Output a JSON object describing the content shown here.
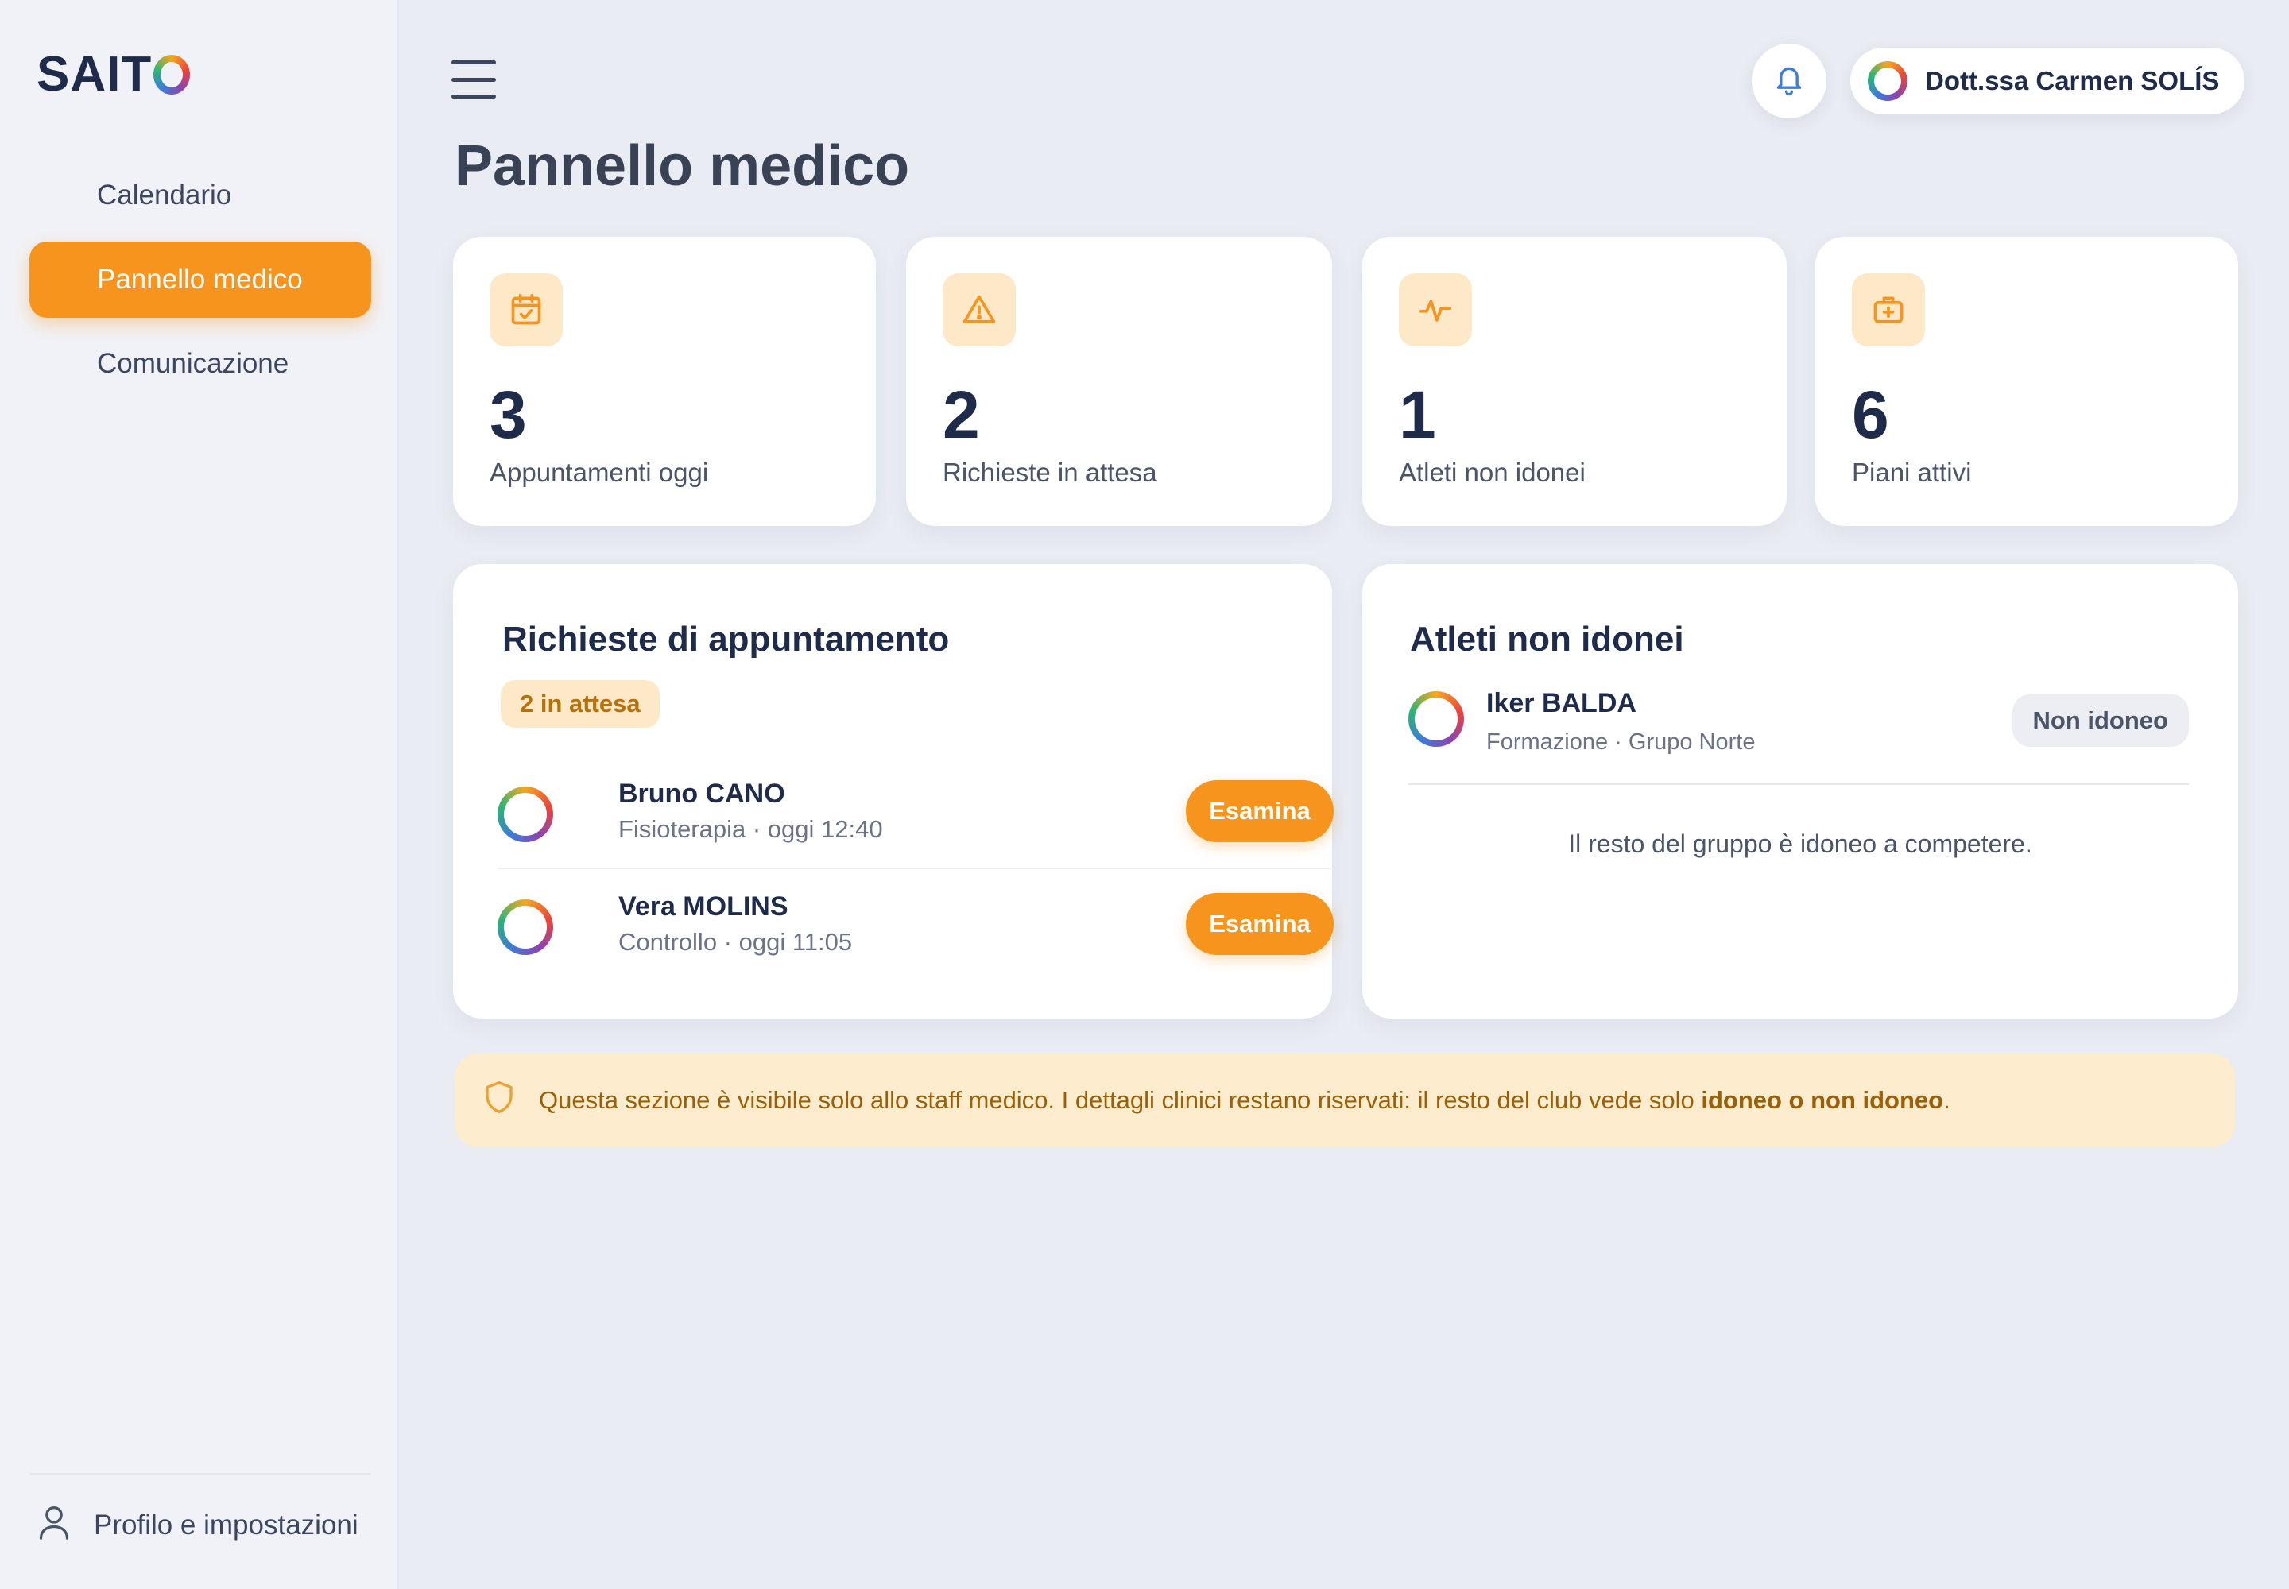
{
  "sidebar": {
    "logo_text": "SAIT",
    "items": [
      {
        "label": "Calendario"
      },
      {
        "label": "Pannello medico"
      },
      {
        "label": "Comunicazione"
      }
    ],
    "profile_label": "Profilo e impostazioni"
  },
  "header": {
    "user_name": "Dott.ssa Carmen SOLÍS"
  },
  "page": {
    "title": "Pannello medico"
  },
  "stats": [
    {
      "icon": "calendar-check-icon",
      "value": "3",
      "label": "Appuntamenti oggi"
    },
    {
      "icon": "warning-icon",
      "value": "2",
      "label": "Richieste in attesa"
    },
    {
      "icon": "activity-icon",
      "value": "1",
      "label": "Atleti non idonei"
    },
    {
      "icon": "medical-kit-icon",
      "value": "6",
      "label": "Piani attivi"
    }
  ],
  "requests": {
    "title": "Richieste di appuntamento",
    "badge": "2 in attesa",
    "items": [
      {
        "name": "Bruno CANO",
        "sub": "Fisioterapia · oggi 12:40",
        "action": "Esamina"
      },
      {
        "name": "Vera MOLINS",
        "sub": "Controllo · oggi 11:05",
        "action": "Esamina"
      }
    ]
  },
  "unfit": {
    "title": "Atleti non idonei",
    "athlete": {
      "name": "Iker BALDA",
      "sub": "Formazione · Grupo Norte",
      "status": "Non idoneo"
    },
    "note": "Il resto del gruppo è idoneo a competere."
  },
  "notice": {
    "text": "Questa sezione è visibile solo allo staff medico.  I dettagli clinici restano riservati: il resto del club vede solo ",
    "emphasis": "idoneo o non idoneo",
    "end": "."
  },
  "colors": {
    "accent": "#f7941d",
    "accent_soft": "#fde8c8",
    "text_dark": "#1e2b4a",
    "background": "#e9ecf3"
  }
}
